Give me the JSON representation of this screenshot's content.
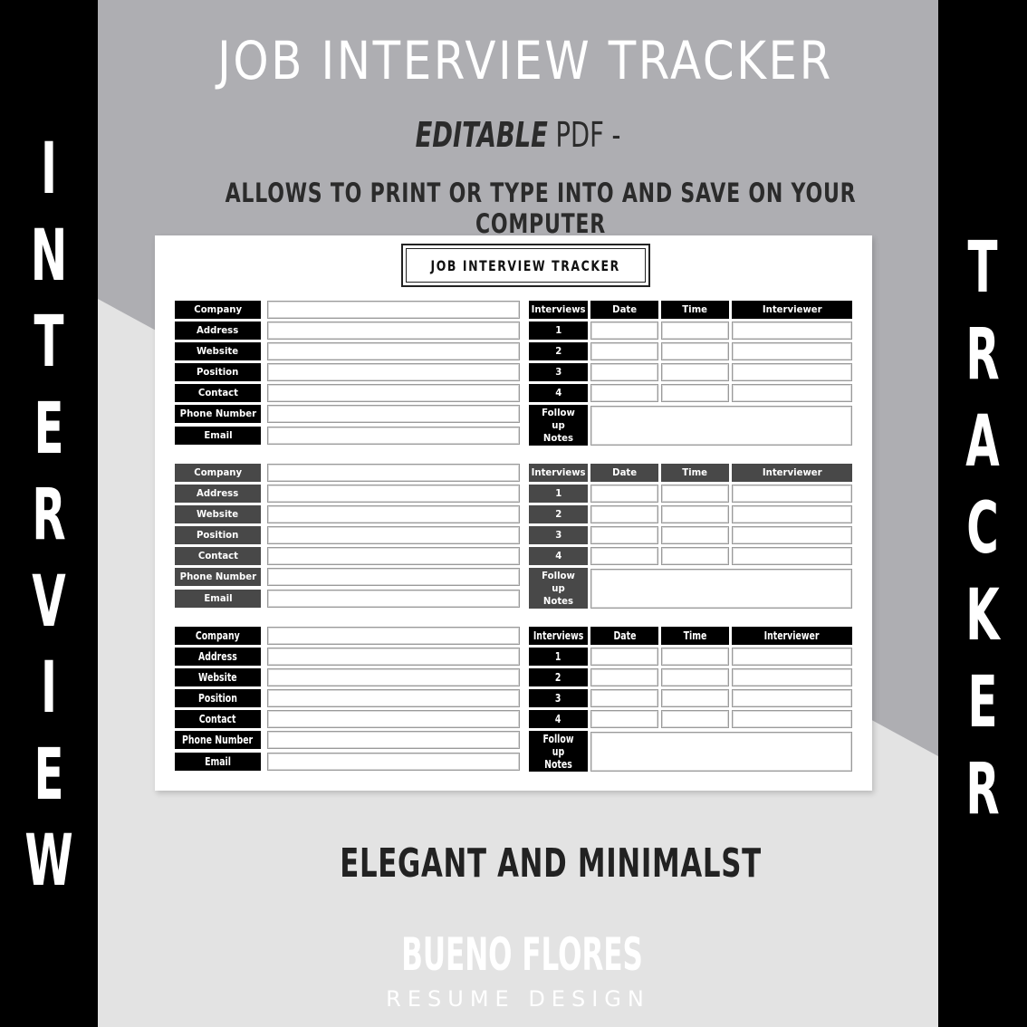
{
  "colors": {
    "strip": "#000000",
    "upper_bg": "#aeaeb2",
    "lower_bg": "#e3e3e3",
    "label_black": "#000000",
    "label_gray": "#484848"
  },
  "side_banners": {
    "left_word": "INTERVIEW",
    "right_word": "TRACKER"
  },
  "hero": {
    "title": "JOB INTERVIEW TRACKER",
    "subtitle_italic": "EDITABLE",
    "subtitle_rest": " PDF -",
    "description": "ALLOWS TO PRINT OR TYPE INTO AND SAVE ON YOUR COMPUTER"
  },
  "paper": {
    "title": "JOB INTERVIEW TRACKER",
    "company_fields": [
      "Company",
      "Address",
      "Website",
      "Position",
      "Contact",
      "Phone Number",
      "Email"
    ],
    "interview_headers": [
      "Interviews",
      "Date",
      "Time",
      "Interviewer"
    ],
    "interview_rows": [
      "1",
      "2",
      "3",
      "4"
    ],
    "followup_label": "Follow up Notes",
    "sections": [
      {
        "theme": "black"
      },
      {
        "theme": "gray"
      },
      {
        "theme": "black-condensed"
      }
    ]
  },
  "tagline": "ELEGANT AND MINIMALST",
  "brand": {
    "name": "BUENO FLORES",
    "subtitle": "RESUME DESIGN"
  }
}
